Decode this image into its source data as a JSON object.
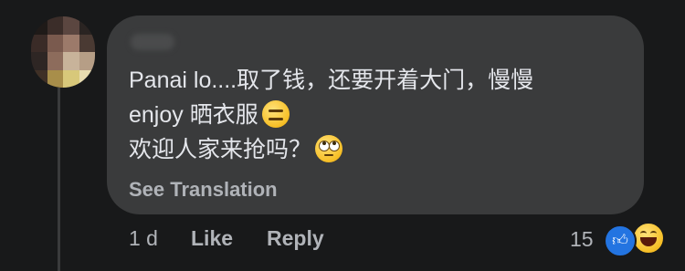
{
  "comment": {
    "lines": [
      "Panai lo....取了钱，还要开着大门，慢慢",
      "enjoy 晒衣服",
      "欢迎人家来抢吗？"
    ],
    "line2_emoji": "expressionless-face-icon",
    "line3_emoji": "face-with-rolling-eyes-icon",
    "see_translation": "See Translation"
  },
  "actions": {
    "time": "1 d",
    "like": "Like",
    "reply": "Reply"
  },
  "reactions": {
    "count": "15",
    "types": [
      "like-reaction-icon",
      "haha-reaction-icon"
    ]
  },
  "colors": {
    "background": "#18191a",
    "bubble": "#3a3b3c",
    "text": "#e4e6eb",
    "secondary_text": "#b0b3b8",
    "like_blue": "#2374e1"
  }
}
